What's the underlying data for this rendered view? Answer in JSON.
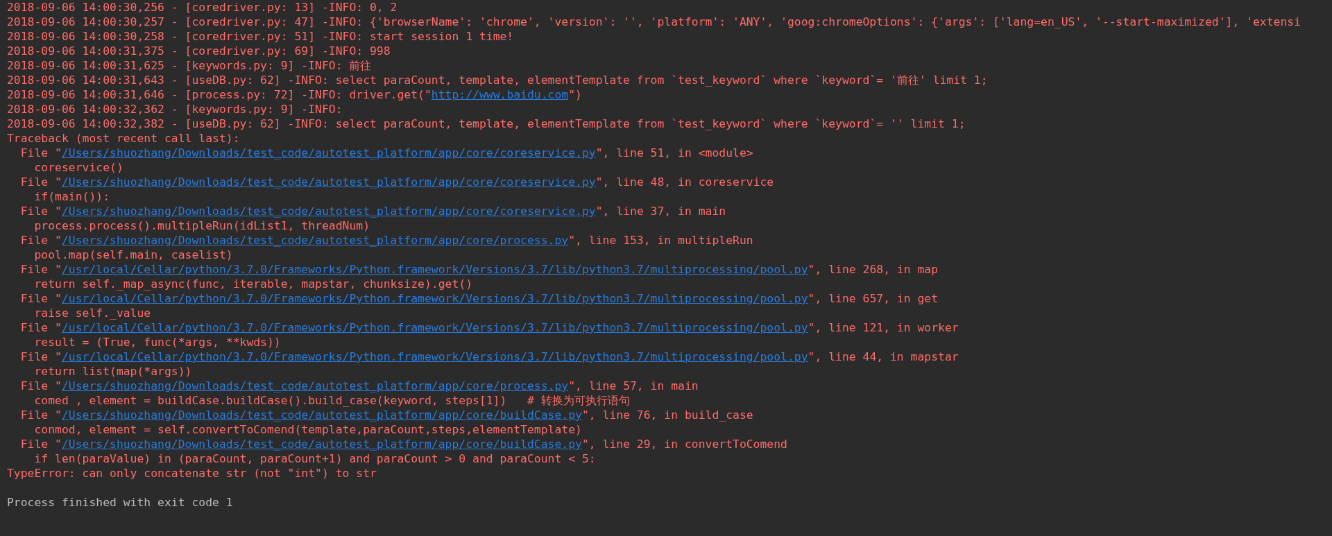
{
  "console": {
    "lines": [
      {
        "kind": "log",
        "segments": [
          {
            "text": "2018-09-06 14:00:30,256 - [coredriver.py: 13] -INFO: 0, 2",
            "link": false
          }
        ]
      },
      {
        "kind": "log",
        "segments": [
          {
            "text": "2018-09-06 14:00:30,257 - [coredriver.py: 47] -INFO: {'browserName': 'chrome', 'version': '', 'platform': 'ANY', 'goog:chromeOptions': {'args': ['lang=en_US', '--start-maximized'], 'extensi",
            "link": false
          }
        ]
      },
      {
        "kind": "log",
        "segments": [
          {
            "text": "2018-09-06 14:00:30,258 - [coredriver.py: 51] -INFO: start session 1 time!",
            "link": false
          }
        ]
      },
      {
        "kind": "log",
        "segments": [
          {
            "text": "2018-09-06 14:00:31,375 - [coredriver.py: 69] -INFO: 998",
            "link": false
          }
        ]
      },
      {
        "kind": "log",
        "segments": [
          {
            "text": "2018-09-06 14:00:31,625 - [keywords.py: 9] -INFO: 前往",
            "link": false
          }
        ]
      },
      {
        "kind": "log",
        "segments": [
          {
            "text": "2018-09-06 14:00:31,643 - [useDB.py: 62] -INFO: select paraCount, template, elementTemplate from `test_keyword` where `keyword`= '前往' limit 1;",
            "link": false
          }
        ]
      },
      {
        "kind": "log",
        "segments": [
          {
            "text": "2018-09-06 14:00:31,646 - [process.py: 72] -INFO: driver.get(\"",
            "link": false
          },
          {
            "text": "http://www.baidu.com",
            "link": true
          },
          {
            "text": "\")",
            "link": false
          }
        ]
      },
      {
        "kind": "log",
        "segments": [
          {
            "text": "2018-09-06 14:00:32,362 - [keywords.py: 9] -INFO:",
            "link": false
          }
        ]
      },
      {
        "kind": "log",
        "segments": [
          {
            "text": "2018-09-06 14:00:32,382 - [useDB.py: 62] -INFO: select paraCount, template, elementTemplate from `test_keyword` where `keyword`= '' limit 1;",
            "link": false
          }
        ]
      },
      {
        "kind": "traceback",
        "segments": [
          {
            "text": "Traceback (most recent call last):",
            "link": false
          }
        ]
      },
      {
        "kind": "frame",
        "segments": [
          {
            "text": "File \"",
            "link": false
          },
          {
            "text": "/Users/shuozhang/Downloads/test_code/autotest_platform/app/core/coreservice.py",
            "link": true
          },
          {
            "text": "\", line 51, in <module>",
            "link": false
          }
        ]
      },
      {
        "kind": "code",
        "segments": [
          {
            "text": "coreservice()",
            "link": false
          }
        ]
      },
      {
        "kind": "frame",
        "segments": [
          {
            "text": "File \"",
            "link": false
          },
          {
            "text": "/Users/shuozhang/Downloads/test_code/autotest_platform/app/core/coreservice.py",
            "link": true
          },
          {
            "text": "\", line 48, in coreservice",
            "link": false
          }
        ]
      },
      {
        "kind": "code",
        "segments": [
          {
            "text": "if(main()):",
            "link": false
          }
        ]
      },
      {
        "kind": "frame",
        "segments": [
          {
            "text": "File \"",
            "link": false
          },
          {
            "text": "/Users/shuozhang/Downloads/test_code/autotest_platform/app/core/coreservice.py",
            "link": true
          },
          {
            "text": "\", line 37, in main",
            "link": false
          }
        ]
      },
      {
        "kind": "code",
        "segments": [
          {
            "text": "process.process().multipleRun(idList1, threadNum)",
            "link": false
          }
        ]
      },
      {
        "kind": "frame",
        "segments": [
          {
            "text": "File \"",
            "link": false
          },
          {
            "text": "/Users/shuozhang/Downloads/test_code/autotest_platform/app/core/process.py",
            "link": true
          },
          {
            "text": "\", line 153, in multipleRun",
            "link": false
          }
        ]
      },
      {
        "kind": "code",
        "segments": [
          {
            "text": "pool.map(self.main, caselist)",
            "link": false
          }
        ]
      },
      {
        "kind": "frame",
        "segments": [
          {
            "text": "File \"",
            "link": false
          },
          {
            "text": "/usr/local/Cellar/python/3.7.0/Frameworks/Python.framework/Versions/3.7/lib/python3.7/multiprocessing/pool.py",
            "link": true
          },
          {
            "text": "\", line 268, in map",
            "link": false
          }
        ]
      },
      {
        "kind": "code",
        "segments": [
          {
            "text": "return self._map_async(func, iterable, mapstar, chunksize).get()",
            "link": false
          }
        ]
      },
      {
        "kind": "frame",
        "segments": [
          {
            "text": "File \"",
            "link": false
          },
          {
            "text": "/usr/local/Cellar/python/3.7.0/Frameworks/Python.framework/Versions/3.7/lib/python3.7/multiprocessing/pool.py",
            "link": true
          },
          {
            "text": "\", line 657, in get",
            "link": false
          }
        ]
      },
      {
        "kind": "code",
        "segments": [
          {
            "text": "raise self._value",
            "link": false
          }
        ]
      },
      {
        "kind": "frame",
        "segments": [
          {
            "text": "File \"",
            "link": false
          },
          {
            "text": "/usr/local/Cellar/python/3.7.0/Frameworks/Python.framework/Versions/3.7/lib/python3.7/multiprocessing/pool.py",
            "link": true
          },
          {
            "text": "\", line 121, in worker",
            "link": false
          }
        ]
      },
      {
        "kind": "code",
        "segments": [
          {
            "text": "result = (True, func(*args, **kwds))",
            "link": false
          }
        ]
      },
      {
        "kind": "frame",
        "segments": [
          {
            "text": "File \"",
            "link": false
          },
          {
            "text": "/usr/local/Cellar/python/3.7.0/Frameworks/Python.framework/Versions/3.7/lib/python3.7/multiprocessing/pool.py",
            "link": true
          },
          {
            "text": "\", line 44, in mapstar",
            "link": false
          }
        ]
      },
      {
        "kind": "code",
        "segments": [
          {
            "text": "return list(map(*args))",
            "link": false
          }
        ]
      },
      {
        "kind": "frame",
        "segments": [
          {
            "text": "File \"",
            "link": false
          },
          {
            "text": "/Users/shuozhang/Downloads/test_code/autotest_platform/app/core/process.py",
            "link": true
          },
          {
            "text": "\", line 57, in main",
            "link": false
          }
        ]
      },
      {
        "kind": "code",
        "segments": [
          {
            "text": "comed , element = buildCase.buildCase().build_case(keyword, steps[1])   # 转换为可执行语句",
            "link": false
          }
        ]
      },
      {
        "kind": "frame",
        "segments": [
          {
            "text": "File \"",
            "link": false
          },
          {
            "text": "/Users/shuozhang/Downloads/test_code/autotest_platform/app/core/buildCase.py",
            "link": true
          },
          {
            "text": "\", line 76, in build_case",
            "link": false
          }
        ]
      },
      {
        "kind": "code",
        "segments": [
          {
            "text": "conmod, element = self.convertToComend(template,paraCount,steps,elementTemplate)",
            "link": false
          }
        ]
      },
      {
        "kind": "frame",
        "segments": [
          {
            "text": "File \"",
            "link": false
          },
          {
            "text": "/Users/shuozhang/Downloads/test_code/autotest_platform/app/core/buildCase.py",
            "link": true
          },
          {
            "text": "\", line 29, in convertToComend",
            "link": false
          }
        ]
      },
      {
        "kind": "code",
        "segments": [
          {
            "text": "if len(paraValue) in (paraCount, paraCount+1) and paraCount > 0 and paraCount < 5:",
            "link": false
          }
        ]
      },
      {
        "kind": "error",
        "segments": [
          {
            "text": "TypeError: can only concatenate str (not \"int\") to str",
            "link": false
          }
        ]
      },
      {
        "kind": "gap"
      },
      {
        "kind": "exit",
        "segments": [
          {
            "text": "Process finished with exit code 1",
            "link": false
          }
        ]
      }
    ]
  }
}
